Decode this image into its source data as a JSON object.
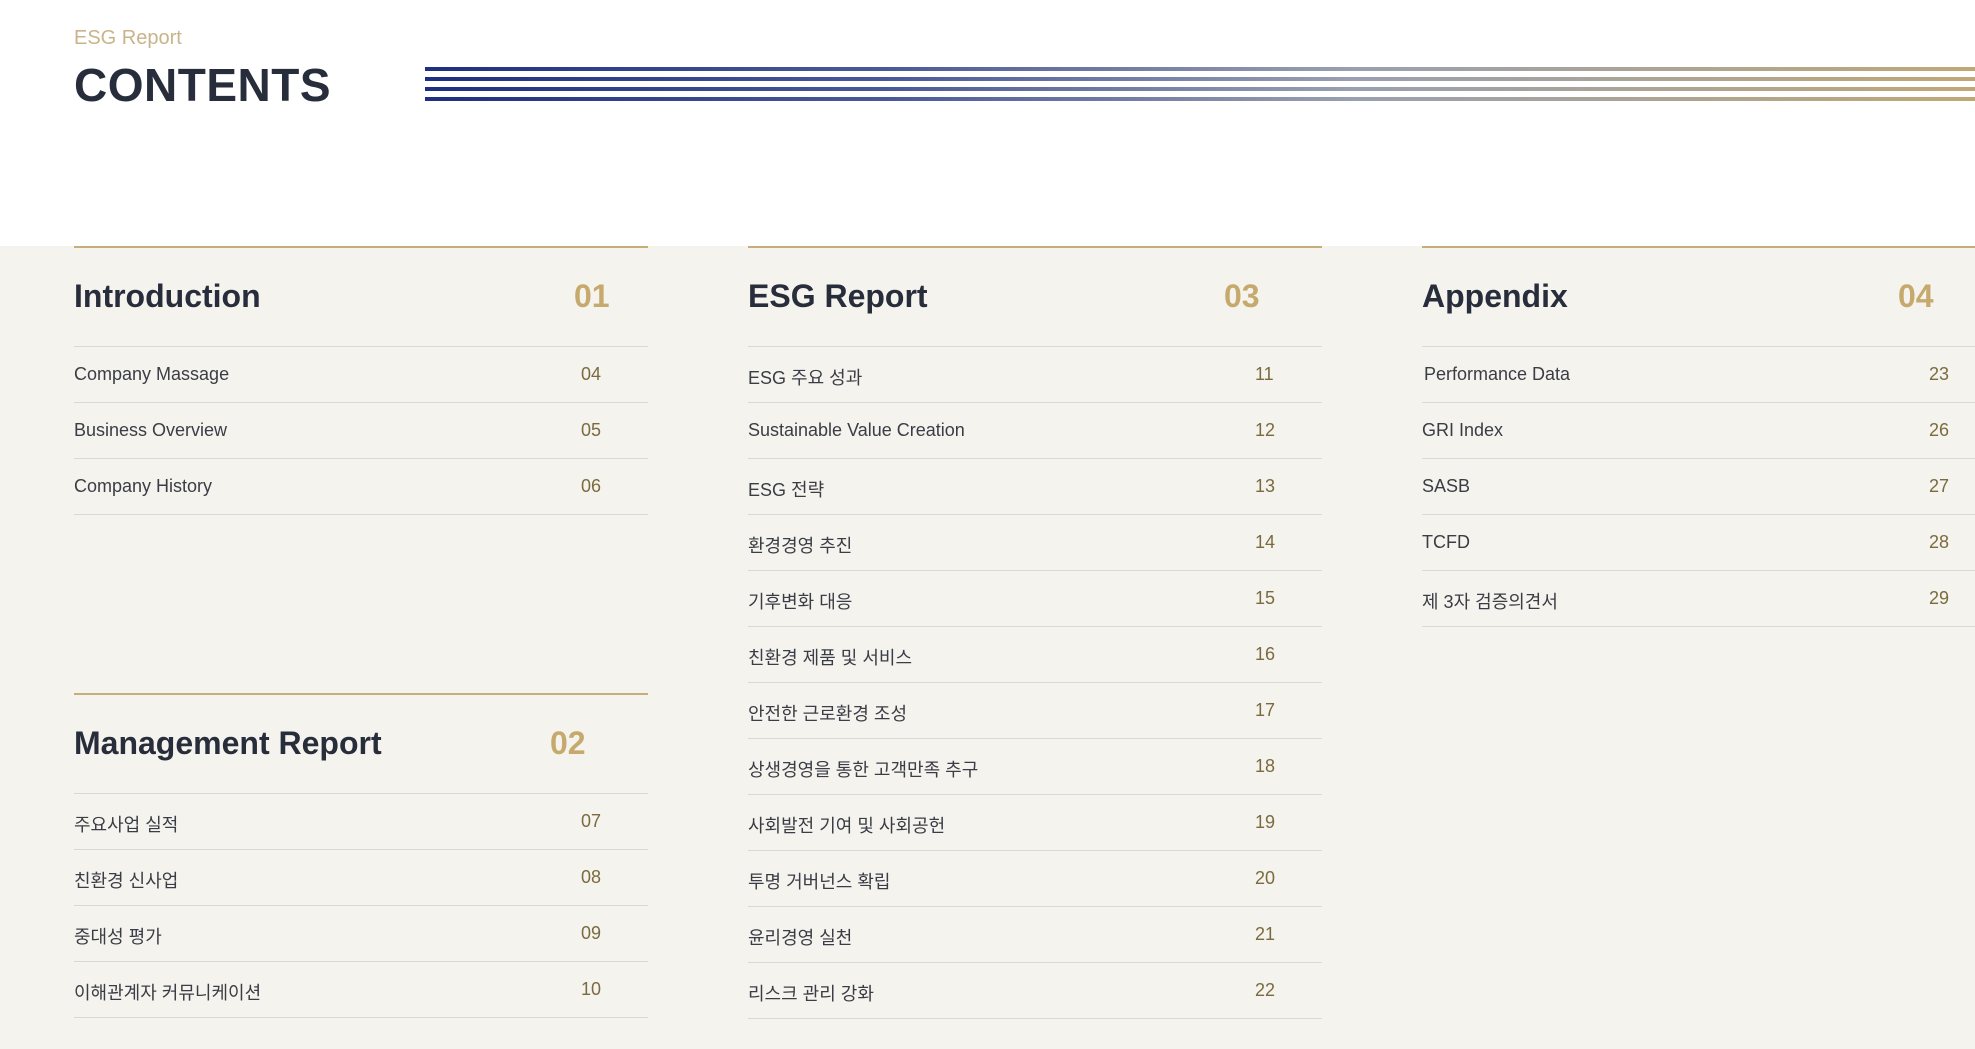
{
  "header": {
    "eyebrow": "ESG Report",
    "title": "CONTENTS"
  },
  "colors": {
    "accent_gold": "#c6ad79",
    "number_gold": "#c6a96d",
    "navy": "#1f2f80",
    "text_dark": "#272d3a",
    "panel_bg": "#f5f3ee"
  },
  "sections": {
    "introduction": {
      "title": "Introduction",
      "number": "01",
      "items": [
        {
          "label": "Company Massage",
          "page": "04"
        },
        {
          "label": "Business Overview",
          "page": "05"
        },
        {
          "label": "Company History",
          "page": "06"
        }
      ]
    },
    "management": {
      "title": "Management Report",
      "number": "02",
      "items": [
        {
          "label": "주요사업 실적",
          "page": "07"
        },
        {
          "label": "친환경 신사업",
          "page": "08"
        },
        {
          "label": "중대성 평가",
          "page": "09"
        },
        {
          "label": "이해관계자 커뮤니케이션",
          "page": "10"
        }
      ]
    },
    "esg": {
      "title": "ESG Report",
      "number": "03",
      "items": [
        {
          "label": "ESG 주요 성과",
          "page": "11"
        },
        {
          "label": "Sustainable Value Creation",
          "page": "12"
        },
        {
          "label": "ESG 전략",
          "page": "13"
        },
        {
          "label": "환경경영 추진",
          "page": "14"
        },
        {
          "label": "기후변화 대응",
          "page": "15"
        },
        {
          "label": "친환경 제품 및 서비스",
          "page": "16"
        },
        {
          "label": "안전한 근로환경 조성",
          "page": "17"
        },
        {
          "label": "상생경영을 통한 고객만족 추구",
          "page": "18"
        },
        {
          "label": "사회발전 기여 및 사회공헌",
          "page": "19"
        },
        {
          "label": "투명 거버넌스 확립",
          "page": "20"
        },
        {
          "label": "윤리경영 실천",
          "page": "21"
        },
        {
          "label": "리스크 관리 강화",
          "page": "22"
        }
      ]
    },
    "appendix": {
      "title": "Appendix",
      "number": "04",
      "items": [
        {
          "label": "Performance Data",
          "page": "23"
        },
        {
          "label": "GRI Index",
          "page": "26"
        },
        {
          "label": "SASB",
          "page": "27"
        },
        {
          "label": "TCFD",
          "page": "28"
        },
        {
          "label": "제 3자 검증의견서",
          "page": "29"
        }
      ]
    }
  }
}
